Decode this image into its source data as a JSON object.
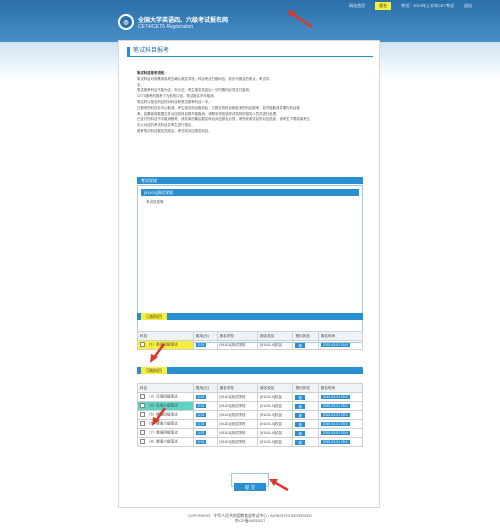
{
  "topbar": {
    "items": [
      "网站首页",
      "报名",
      "考试：2019年上半年CET考试",
      "退出"
    ]
  },
  "brand": {
    "title": "全国大学英语四、六级考试报名网",
    "subtitle": "CET4/CET6 Registration"
  },
  "page": {
    "title": "笔试科目报考"
  },
  "notice": {
    "head": "笔试科目报考须知：",
    "lines": [
      "笔试科目可按需求各考生确认报名学校，科目考试日期对应，你仅可报名的考点、考试学。",
      "手。",
      "笔试报考科目不能为空，你为空。考生报名信息后一旦时期内必须支付费用。",
      "CET6报考的报考了为前的口径，笔试报名不可取消。",
      "笔试时以报名科目的对科目和笔试报考科目一半。",
      "已报考的科目在可以取消。考生报名科目取消后，已报名的科目和取消的科目报考。如不能取消并需在科目报",
      "考。如果使用数据文件对应的科目报不能取消，请联系学校或考试机构的相关人员并进行处理。",
      "已支付的科目不可取消报考。请实体的最后报名科目对应报名必须，请完成考试后的对应信息，请考生下载或者考生",
      "可以对应的考试科目并考生进行报名。",
      "报考笔试科目报名完成后，考试将对应报名科目。"
    ]
  },
  "school_section": {
    "label": "考试学校",
    "school_name": "[91101]测试学校",
    "school_sub": "考试信息等"
  },
  "reported": {
    "label": "已报科目",
    "headers": [
      "科目",
      "费用(元)",
      "报名学校",
      "报名校区",
      "预约状态",
      "报名时间"
    ],
    "rows": [
      [
        "（1）英语四级笔试",
        "0.01",
        "[91101]测试学校",
        "[91101-0]校区",
        "报",
        "2019-03-01 09:0"
      ]
    ]
  },
  "available": {
    "label": "可报科目",
    "headers": [
      "科目",
      "费用(元)",
      "报名学校",
      "报名校区",
      "预约状态",
      "报名时间"
    ],
    "rows": [
      [
        "（3）日语四级笔试",
        "0.01",
        "[91101]测试学校",
        "[91101-0]校区",
        "报",
        "2019-03-01 09:0"
      ],
      [
        "（4）日语六级笔试",
        "0.01",
        "[91101]测试学校",
        "[91101-0]校区",
        "报",
        "2019-03-01 09:0"
      ],
      [
        "（5）德语四级笔试",
        "0.01",
        "[91101]测试学校",
        "[91101-0]校区",
        "报",
        "2019-03-01 09:0"
      ],
      [
        "（6）德语六级笔试",
        "0.01",
        "[91101]测试学校",
        "[91101-0]校区",
        "报",
        "2019-03-01 09:0"
      ],
      [
        "（7）俄语四级笔试",
        "0.01",
        "[91101]测试学校",
        "[91101-0]校区",
        "报",
        "2019-03-01 09:0"
      ],
      [
        "（8）俄语六级笔试",
        "0.01",
        "[91101]测试学校",
        "[91101-0]校区",
        "报",
        "2019-03-01 09:0"
      ]
    ]
  },
  "submit": {
    "label": "提 交"
  },
  "footer": {
    "line1": "COPYRIGHT : 中华人民共和国教育部考试中心 / All RIGHTS RESERVED",
    "line2": "京ICP备05031027"
  },
  "colors": {
    "accent": "#2a8fd0",
    "header": "#2a6fa8",
    "highlight_yellow": "#f6ef3b",
    "highlight_teal": "#5ed3c1",
    "arrow": "#d83a2a"
  }
}
